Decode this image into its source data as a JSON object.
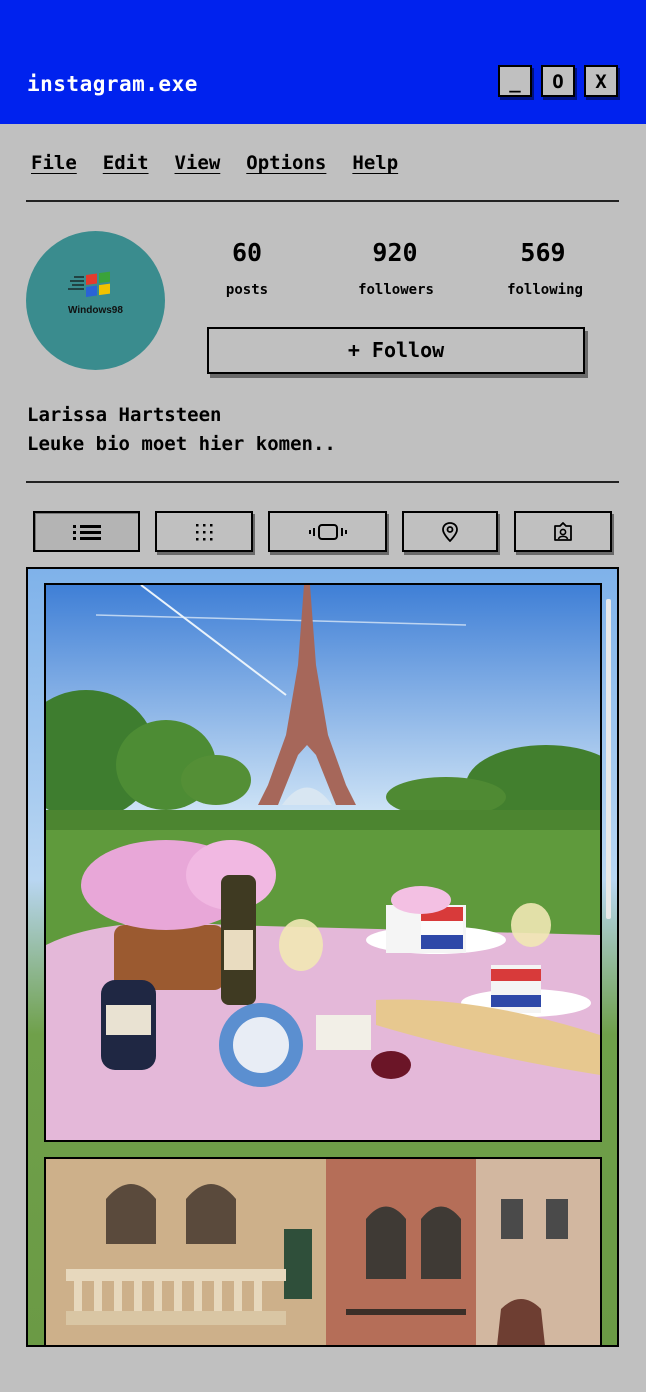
{
  "window": {
    "title": "instagram.exe",
    "minimize_label": "_",
    "maximize_label": "O",
    "close_label": "X",
    "accent_color": "#0022ee"
  },
  "menu": [
    "File",
    "Edit",
    "View",
    "Options",
    "Help"
  ],
  "profile": {
    "avatar_icon": "windows-98-logo",
    "avatar_text": "Windows98",
    "stats": [
      {
        "value": "60",
        "label": "posts"
      },
      {
        "value": "920",
        "label": "followers"
      },
      {
        "value": "569",
        "label": "following"
      }
    ],
    "follow_label": "+ Follow",
    "name": "Larissa Hartsteen",
    "bio": "Leuke bio moet hier komen.."
  },
  "tabs": [
    {
      "icon": "list-icon"
    },
    {
      "icon": "grid-icon"
    },
    {
      "icon": "reels-icon"
    },
    {
      "icon": "location-icon"
    },
    {
      "icon": "tagged-icon"
    }
  ],
  "feed": {
    "posts": [
      {
        "image": "eiffel-tower-picnic-photo"
      },
      {
        "image": "venice-buildings-photo"
      }
    ]
  }
}
